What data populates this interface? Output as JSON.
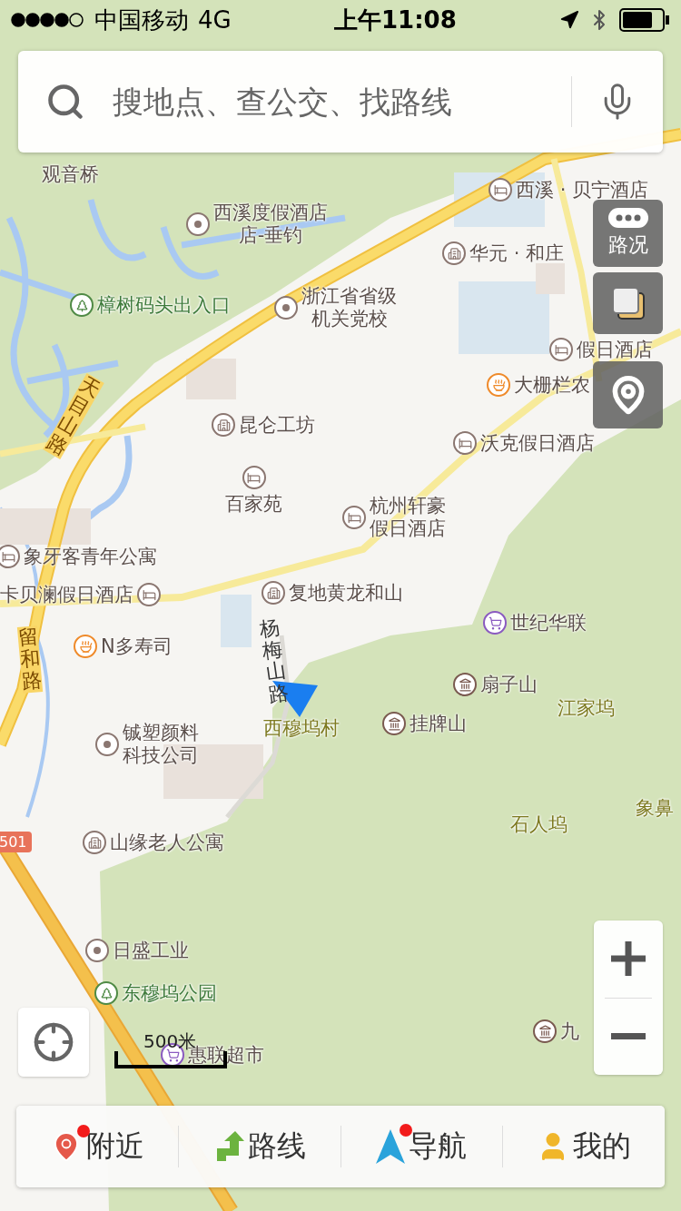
{
  "status_bar": {
    "carrier": "中国移动",
    "network": "4G",
    "time": "上午11:08"
  },
  "search": {
    "placeholder": "搜地点、查公交、找路线"
  },
  "map_controls": {
    "traffic": "路况"
  },
  "map": {
    "pois": [
      {
        "kind": "place",
        "name": "观音桥"
      },
      {
        "kind": "hotel",
        "name": "西溪 · 贝宁酒店"
      },
      {
        "kind": "dot",
        "name": "西溪度假酒店店-垂钓"
      },
      {
        "kind": "building",
        "name": "华元 · 和庄"
      },
      {
        "kind": "park",
        "name": "樟树码头出入口"
      },
      {
        "kind": "dot",
        "name": "浙江省省级机关党校"
      },
      {
        "kind": "hotel",
        "name": "假日酒店"
      },
      {
        "kind": "restaurant",
        "name": "大栅栏农"
      },
      {
        "kind": "building",
        "name": "昆仑工坊"
      },
      {
        "kind": "hotel",
        "name": "沃克假日酒店"
      },
      {
        "kind": "hotel",
        "name": "百家苑"
      },
      {
        "kind": "hotel",
        "name": "杭州轩豪假日酒店"
      },
      {
        "kind": "hotel",
        "name": "象牙客青年公寓"
      },
      {
        "kind": "hotel",
        "name": "卡贝澜假日酒店"
      },
      {
        "kind": "building",
        "name": "复地黄龙和山"
      },
      {
        "kind": "shop",
        "name": "世纪华联"
      },
      {
        "kind": "restaurant",
        "name": "N多寿司"
      },
      {
        "kind": "temple",
        "name": "扇子山"
      },
      {
        "kind": "area",
        "name": "江家坞"
      },
      {
        "kind": "area",
        "name": "西穆坞村"
      },
      {
        "kind": "temple",
        "name": "挂牌山"
      },
      {
        "kind": "dot",
        "name": "铖塑颜料科技公司"
      },
      {
        "kind": "area",
        "name": "石人坞"
      },
      {
        "kind": "area",
        "name": "象鼻"
      },
      {
        "kind": "building",
        "name": "山缘老人公寓"
      },
      {
        "kind": "dot",
        "name": "日盛工业"
      },
      {
        "kind": "park",
        "name": "东穆坞公园"
      },
      {
        "kind": "shop",
        "name": "惠联超市"
      },
      {
        "kind": "temple",
        "name": "九"
      }
    ],
    "roads": [
      {
        "name": "天目山路"
      },
      {
        "name": "留和路"
      },
      {
        "name": "杨梅山路"
      }
    ],
    "route_badge": "501"
  },
  "scale": "500米",
  "tabs": [
    {
      "label": "附近",
      "badge": true
    },
    {
      "label": "路线",
      "badge": false
    },
    {
      "label": "导航",
      "badge": true
    },
    {
      "label": "我的",
      "badge": false
    }
  ]
}
